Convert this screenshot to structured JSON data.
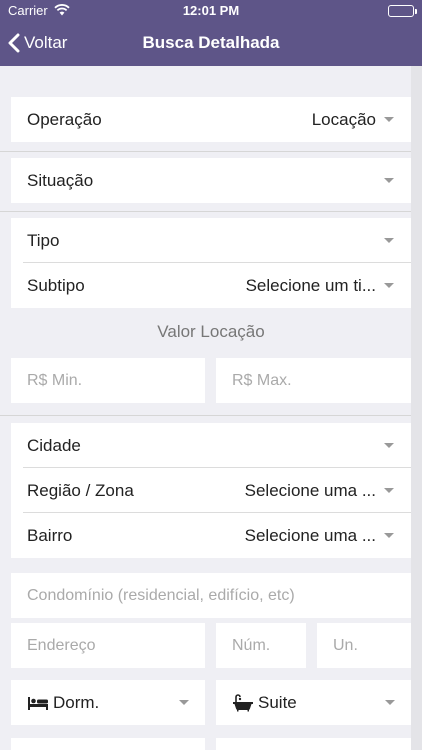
{
  "status_bar": {
    "carrier": "Carrier",
    "time": "12:01 PM"
  },
  "nav": {
    "back_label": "Voltar",
    "title": "Busca Detalhada"
  },
  "form": {
    "operacao": {
      "label": "Operação",
      "value": "Locação"
    },
    "situacao": {
      "label": "Situação",
      "value": ""
    },
    "tipo": {
      "label": "Tipo",
      "value": ""
    },
    "subtipo": {
      "label": "Subtipo",
      "value": "Selecione um ti..."
    },
    "valor_section_title": "Valor Locação",
    "valor_min_placeholder": "R$ Min.",
    "valor_max_placeholder": "R$ Max.",
    "cidade": {
      "label": "Cidade",
      "value": ""
    },
    "regiao": {
      "label": "Região / Zona",
      "value": "Selecione uma ..."
    },
    "bairro": {
      "label": "Bairro",
      "value": "Selecione uma ..."
    },
    "condominio_placeholder": "Condomínio (residencial, edifício, etc)",
    "endereco_placeholder": "Endereço",
    "numero_placeholder": "Núm.",
    "unidade_placeholder": "Un.",
    "dorm": {
      "label": "Dorm.",
      "icon": "bed-icon"
    },
    "suite": {
      "label": "Suite",
      "icon": "bathtub-icon"
    }
  },
  "colors": {
    "header": "#5e5588",
    "background": "#efeff4",
    "caret": "#999999"
  }
}
